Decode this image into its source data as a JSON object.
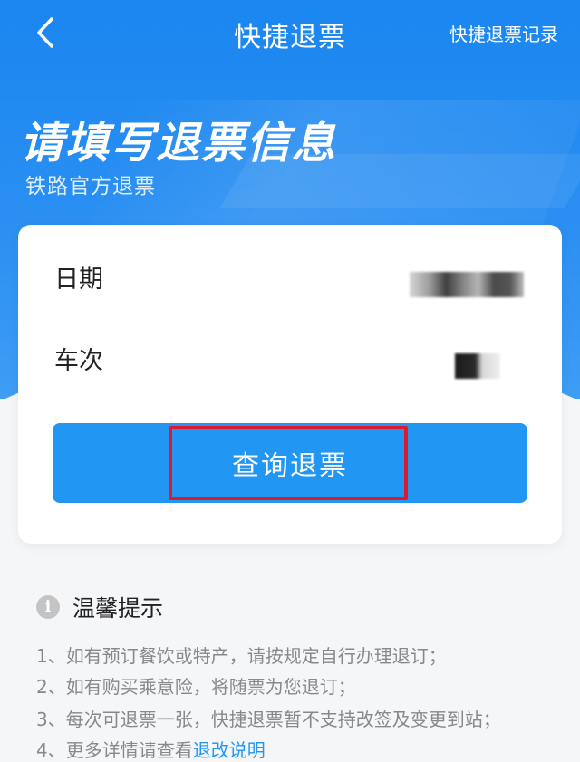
{
  "nav": {
    "title": "快捷退票",
    "right_link": "快捷退票记录"
  },
  "hero": {
    "headline": "请填写退票信息",
    "subline": "铁路官方退票"
  },
  "form": {
    "rows": [
      {
        "label": "日期",
        "value": "(blurred)"
      },
      {
        "label": "车次",
        "value": "(blurred)"
      }
    ],
    "query_button": "查询退票"
  },
  "tips": {
    "title": "温馨提示",
    "items": [
      "1、如有预订餐饮或特产，请按规定自行办理退订；",
      "2、如有购买乘意险，将随票为您退订；",
      "3、每次可退票一张，快捷退票暂不支持改签及变更到站；"
    ],
    "item4_prefix": "4、更多详情请查看",
    "item4_link": "退改说明"
  },
  "colors": {
    "primary": "#2196f3",
    "header_blue": "#1a86f0",
    "highlight_red": "#e0182d"
  },
  "icons": {
    "back": "chevron-left-icon",
    "info": "info-circle-icon"
  }
}
